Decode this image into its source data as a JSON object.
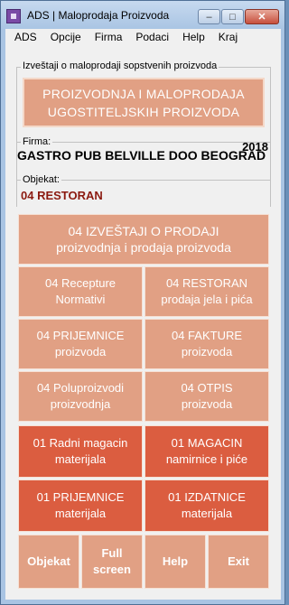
{
  "window": {
    "title": "ADS | Maloprodaja Proizvoda",
    "controls": {
      "minimize": "–",
      "maximize": "□",
      "close": "✕"
    }
  },
  "menu": [
    "ADS",
    "Opcije",
    "Firma",
    "Podaci",
    "Help",
    "Kraj"
  ],
  "header": {
    "group_label": "Izveštaji o maloprodaji sopstvenih proizvoda",
    "main_button": {
      "line1": "PROIZVODNJA I MALOPRODAJA",
      "line2": "UGOSTITELJSKIH PROIZVODA"
    }
  },
  "firma": {
    "label": "Firma:",
    "year": "2018",
    "name": "GASTRO PUB BELVILLE DOO BEOGRAD"
  },
  "objekat": {
    "label": "Objekat:",
    "name": "04 RESTORAN"
  },
  "tiles": {
    "izvestaji": {
      "line1": "04  IZVEŠTAJI O PRODAJI",
      "line2": "proizvodnja i prodaja proizvoda"
    },
    "recepture": {
      "line1": "04 Recepture",
      "line2": "Normativi"
    },
    "restoran": {
      "line1": "04 RESTORAN",
      "line2": "prodaja jela i pića"
    },
    "prijemnice04": {
      "line1": "04 PRIJEMNICE",
      "line2": "proizvoda"
    },
    "fakture": {
      "line1": "04 FAKTURE",
      "line2": "proizvoda"
    },
    "poluproizvodi": {
      "line1": "04 Poluproizvodi",
      "line2": "proizvodnja"
    },
    "otpis": {
      "line1": "04 OTPIS",
      "line2": "proizvoda"
    },
    "radni_magacin": {
      "line1": "01 Radni magacin",
      "line2": "materijala"
    },
    "magacin": {
      "line1": "01 MAGACIN",
      "line2": "namirnice i piće"
    },
    "prijemnice01": {
      "line1": "01 PRIJEMNICE",
      "line2": "materijala"
    },
    "izdatnice": {
      "line1": "01 IZDATNICE",
      "line2": "materijala"
    }
  },
  "bottom": {
    "objekat": "Objekat",
    "fullscreen_line1": "Full",
    "fullscreen_line2": "screen",
    "help": "Help",
    "exit": "Exit"
  },
  "colors": {
    "tile_light": "#e1a084",
    "tile_dark": "#db5d40",
    "objekat_text": "#8b1a10"
  }
}
